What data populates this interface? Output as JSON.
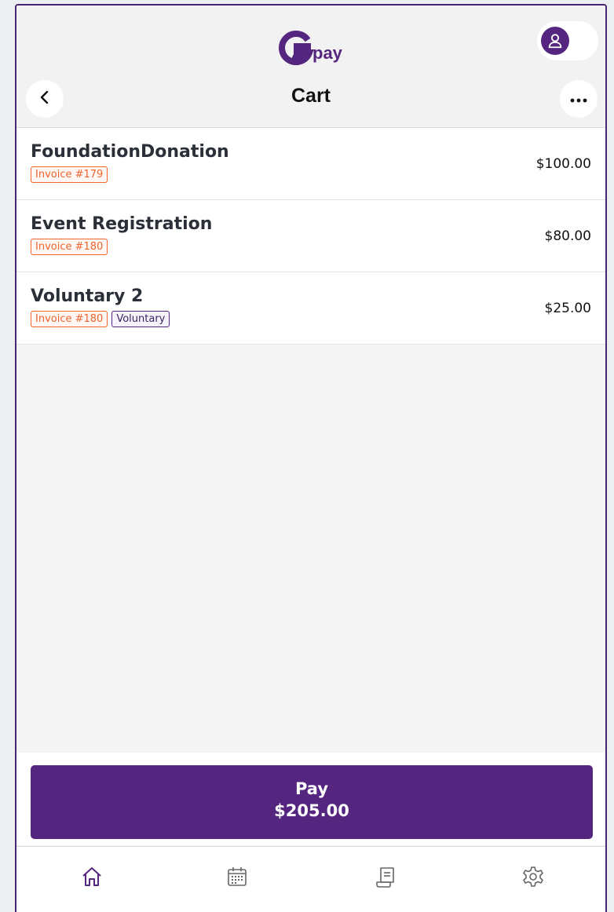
{
  "header": {
    "logo_text": "pay",
    "profile_icon": "user-icon"
  },
  "titlebar": {
    "title": "Cart",
    "back_icon": "chevron-left-icon",
    "more_icon": "more-horizontal-icon"
  },
  "cart": {
    "items": [
      {
        "title": "FoundationDonation",
        "badges": [
          "Invoice #179"
        ],
        "price": "$100.00"
      },
      {
        "title": "Event Registration",
        "badges": [
          "Invoice #180"
        ],
        "price": "$80.00"
      },
      {
        "title": "Voluntary 2",
        "badges": [
          "Invoice #180",
          "Voluntary"
        ],
        "price": "$25.00"
      }
    ]
  },
  "pay": {
    "label": "Pay",
    "amount": "$205.00"
  },
  "nav": {
    "items": [
      {
        "icon": "home-icon",
        "active": true
      },
      {
        "icon": "calendar-icon",
        "active": false
      },
      {
        "icon": "receipt-icon",
        "active": false
      },
      {
        "icon": "gear-icon",
        "active": false
      }
    ]
  },
  "colors": {
    "brand": "#55267f",
    "invoice_badge": "#f0642d",
    "background": "#f4f4f4"
  }
}
